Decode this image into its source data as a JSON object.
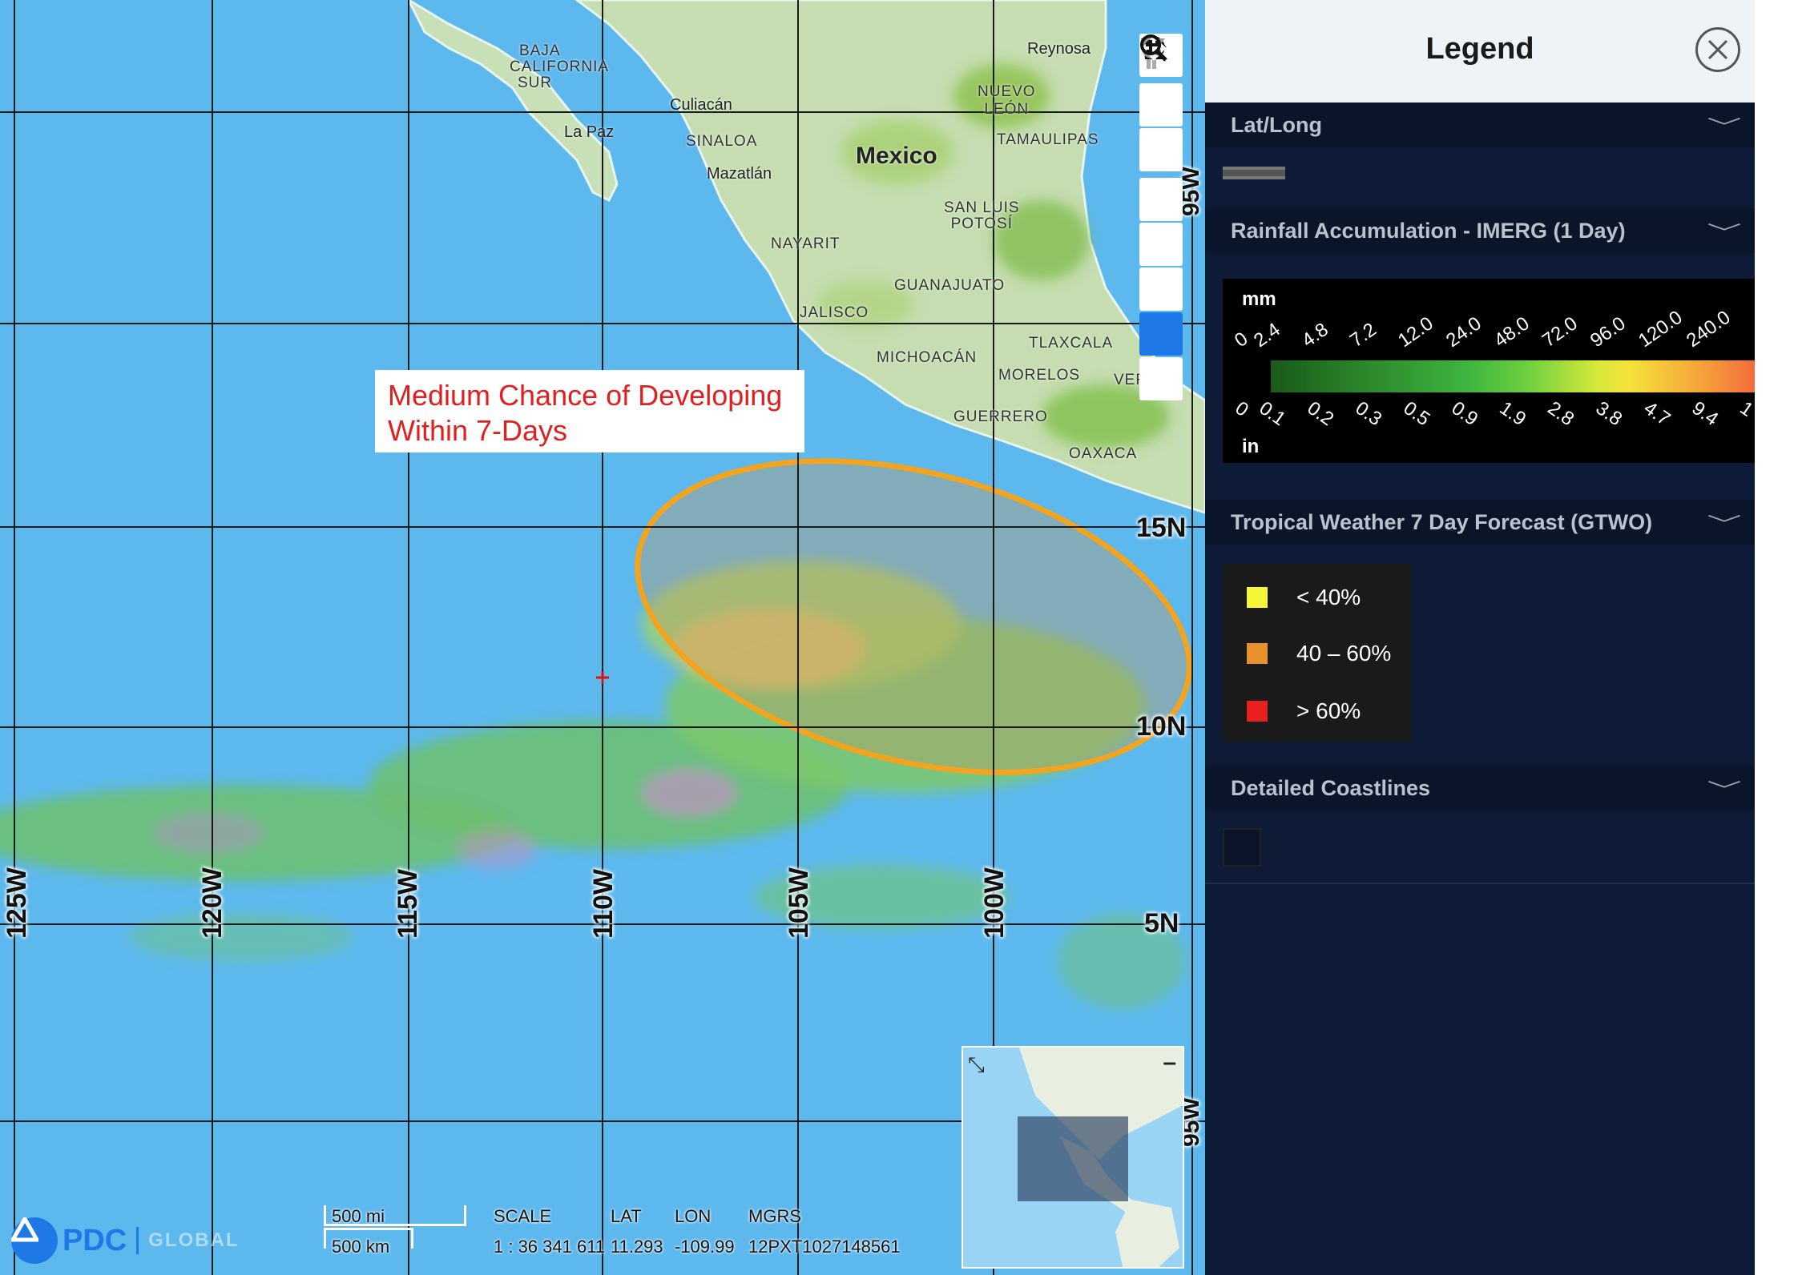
{
  "map": {
    "annotation": [
      "Medium Chance of Developing",
      "Within 7-Days"
    ],
    "lon_labels": [
      "125W",
      "120W",
      "115W",
      "110W",
      "105W",
      "100W"
    ],
    "lat_labels": [
      "15N",
      "10N",
      "5N"
    ],
    "edge_labels": [
      "95W",
      "95W"
    ],
    "places": {
      "country": "Mexico",
      "baja": [
        "BAJA",
        "CALIFORNIA",
        "SUR"
      ],
      "la_paz": "La Paz",
      "culiacan": "Culiacán",
      "sinaloa": "SINALOA",
      "mazatlan": "Mazatlán",
      "nayarit": "NAYARIT",
      "jalisco": "JALISCO",
      "michoacan": "MICHOACÁN",
      "guanajuato": "GUANAJUATO",
      "san_luis": [
        "SAN LUIS",
        "POTOSÍ"
      ],
      "nuevo_leon": [
        "NUEVO",
        "LEÓN"
      ],
      "tamaulipas": "TAMAULIPAS",
      "reynosa": "Reynosa",
      "tlaxcala": "TLAXCALA",
      "morelos": "MORELOS",
      "guerrero": "GUERRERO",
      "oaxaca": "OAXACA",
      "ver": "VER"
    },
    "controls": [
      "street-view",
      "zoom-in",
      "zoom-out",
      "home",
      "rotate-left",
      "rotate-right",
      "pan",
      "zoom-box"
    ],
    "info": {
      "scale_mi": "500 mi",
      "scale_km": "500 km",
      "scale_label": "SCALE",
      "scale_value": "1 : 36 341 611",
      "lat_label": "LAT",
      "lat_value": "11.293",
      "lon_label": "LON",
      "lon_value": "-109.99",
      "mgrs_label": "MGRS",
      "mgrs_value": "12PXT1027148561"
    },
    "logo": {
      "brand": "PDC",
      "sub": "GLOBAL"
    }
  },
  "legend": {
    "title": "Legend",
    "sections": [
      {
        "title": "Lat/Long"
      },
      {
        "title": "Rainfall Accumulation - IMERG (1 Day)"
      },
      {
        "title": "Tropical Weather 7 Day Forecast (GTWO)"
      },
      {
        "title": "Detailed Coastlines"
      }
    ],
    "rainfall": {
      "unit_top": "mm",
      "unit_bottom": "in",
      "mm_ticks": [
        "0",
        "2.4",
        "4.8",
        "7.2",
        "12.0",
        "24.0",
        "48.0",
        "72.0",
        "96.0",
        "120.0",
        "240.0"
      ],
      "in_ticks": [
        "0",
        "0.1",
        "0.2",
        "0.3",
        "0.5",
        "0.9",
        "1.9",
        "2.8",
        "3.8",
        "4.7",
        "9.4",
        "1"
      ]
    },
    "gtwo": [
      {
        "label": "< 40%",
        "color": "#f5f53a"
      },
      {
        "label": "40 – 60%",
        "color": "#e8902a"
      },
      {
        "label": "> 60%",
        "color": "#e82020"
      }
    ]
  }
}
